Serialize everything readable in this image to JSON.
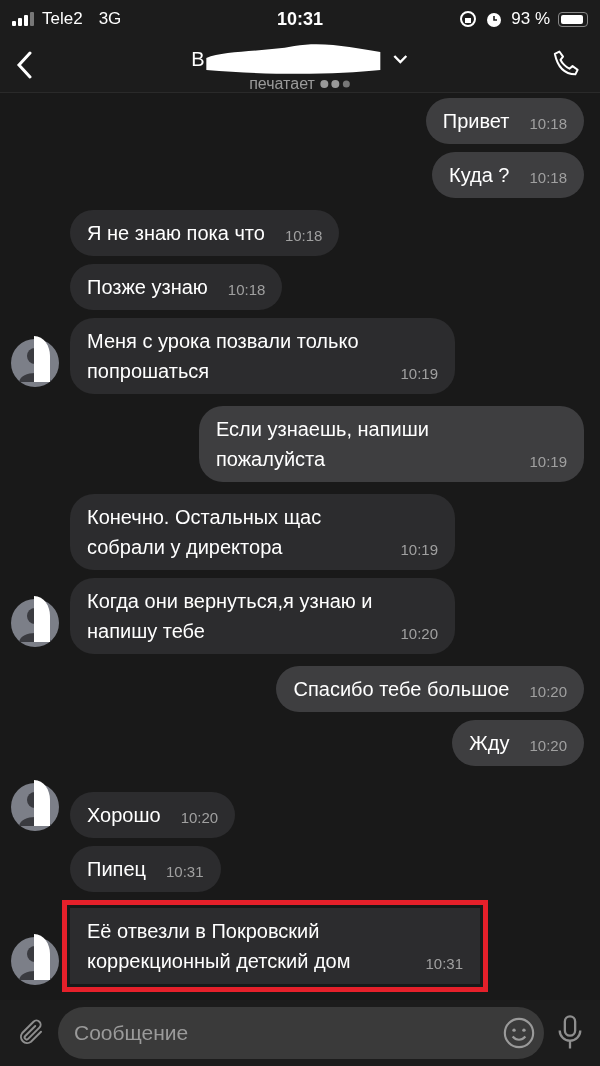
{
  "status_bar": {
    "carrier": "Tele2",
    "network": "3G",
    "time": "10:31",
    "battery": "93 %"
  },
  "header": {
    "title": "В",
    "subtitle": "печатает"
  },
  "messages": [
    {
      "kind": "outgoing",
      "text": "Привет",
      "time": "10:18",
      "avatar": false,
      "highlighted": false
    },
    {
      "kind": "outgoing",
      "text": "Куда ?",
      "time": "10:18",
      "avatar": false,
      "highlighted": false
    },
    {
      "kind": "incoming",
      "text": "Я не знаю пока что",
      "time": "10:18",
      "avatar": false,
      "highlighted": false
    },
    {
      "kind": "incoming",
      "text": "Позже узнаю",
      "time": "10:18",
      "avatar": false,
      "highlighted": false
    },
    {
      "kind": "incoming",
      "text": "Меня с урока позвали только попрошаться",
      "time": "10:19",
      "avatar": true,
      "highlighted": false
    },
    {
      "kind": "outgoing",
      "text": "Если узнаешь, напиши пожалуйста",
      "time": "10:19",
      "avatar": false,
      "highlighted": false
    },
    {
      "kind": "incoming",
      "text": "Конечно. Остальных щас собрали у директора",
      "time": "10:19",
      "avatar": false,
      "highlighted": false
    },
    {
      "kind": "incoming",
      "text": "Когда они вернуться,я узнаю и напишу тебе",
      "time": "10:20",
      "avatar": true,
      "highlighted": false
    },
    {
      "kind": "outgoing",
      "text": "Спасибо тебе большое",
      "time": "10:20",
      "avatar": false,
      "highlighted": false
    },
    {
      "kind": "outgoing",
      "text": "Жду",
      "time": "10:20",
      "avatar": false,
      "highlighted": false
    },
    {
      "kind": "incoming",
      "text": "Хорошо",
      "time": "10:20",
      "avatar": true,
      "highlighted": false
    },
    {
      "kind": "incoming",
      "text": "Пипец",
      "time": "10:31",
      "avatar": false,
      "highlighted": false
    },
    {
      "kind": "incoming",
      "text": "Её отвезли в Покровский коррекционный детский дом",
      "time": "10:31",
      "avatar": true,
      "highlighted": true
    }
  ],
  "composer": {
    "placeholder": "Сообщение"
  }
}
